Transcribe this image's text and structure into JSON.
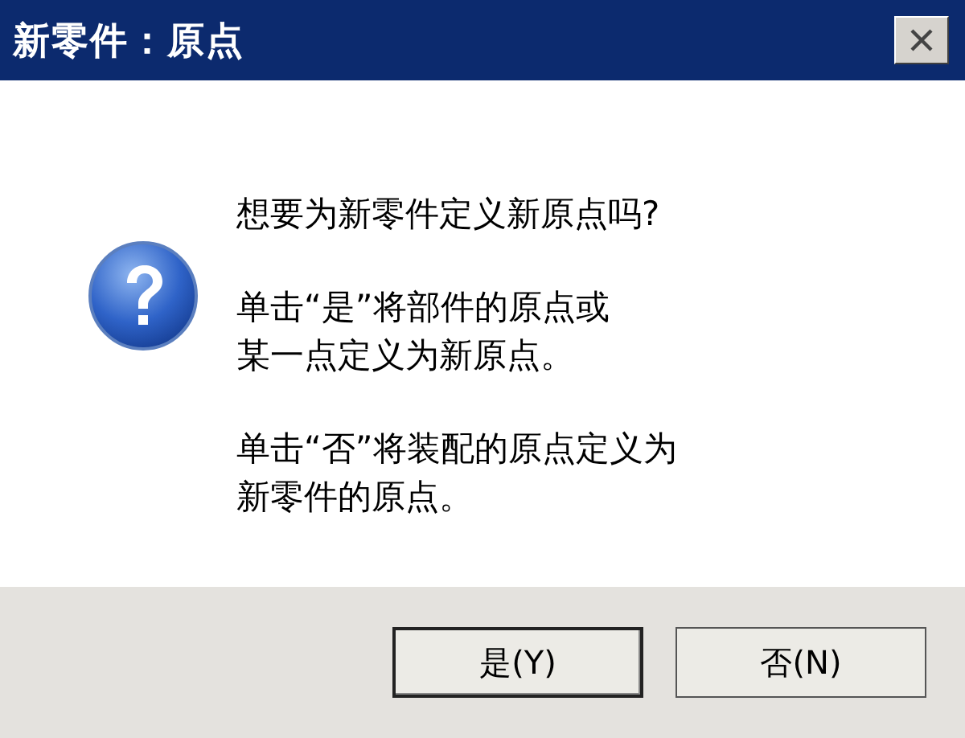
{
  "window": {
    "title": "新零件：原点"
  },
  "message": {
    "question": "想要为新零件定义新原点吗?",
    "paragraphs": [
      [
        "单击“是”将部件的原点或",
        "某一点定义为新原点。"
      ],
      [
        "单击“否”将装配的原点定义为",
        "新零件的原点。"
      ]
    ]
  },
  "buttons": [
    {
      "label": "是(Y)",
      "default": true
    },
    {
      "label": "否(N)",
      "default": false
    }
  ]
}
